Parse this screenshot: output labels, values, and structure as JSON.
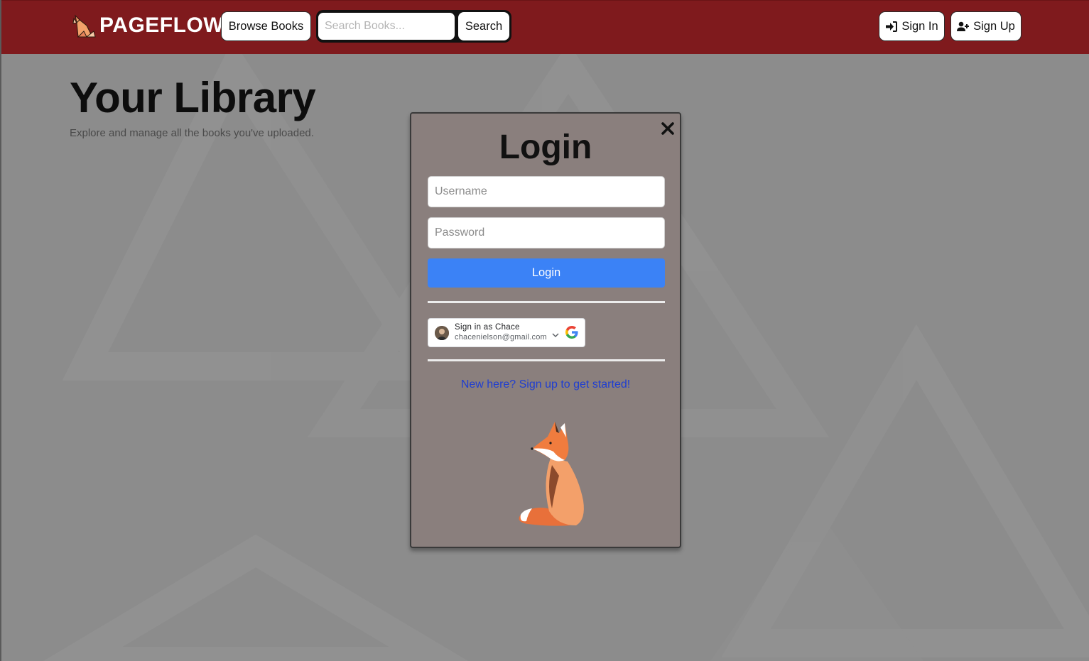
{
  "colors": {
    "navbar_bg": "#7f1a1d",
    "page_bg": "#8c8c8c",
    "modal_bg": "#8a7f7d",
    "login_button": "#3b82f6",
    "signup_link": "#1f3ed1"
  },
  "navbar": {
    "brand_name": "PAGEFLOW",
    "brand_icon": "fox-logo-icon",
    "browse_label": "Browse Books",
    "search": {
      "placeholder": "Search Books...",
      "value": ""
    },
    "search_label": "Search",
    "sign_in_label": "Sign In",
    "sign_in_icon": "sign-in-icon",
    "sign_up_label": "Sign Up",
    "sign_up_icon": "user-plus-icon"
  },
  "page": {
    "title": "Your Library",
    "subtitle": "Explore and manage all the books you've uploaded."
  },
  "login_modal": {
    "title": "Login",
    "close_icon": "close-icon",
    "username": {
      "placeholder": "Username",
      "value": ""
    },
    "password": {
      "placeholder": "Password",
      "value": ""
    },
    "login_label": "Login",
    "google": {
      "name_label": "Sign in as Chace",
      "email": "chacenielson@gmail.com",
      "icon": "google-icon"
    },
    "signup_link": "New here? Sign up to get started!",
    "illustration": "fox-illustration"
  }
}
